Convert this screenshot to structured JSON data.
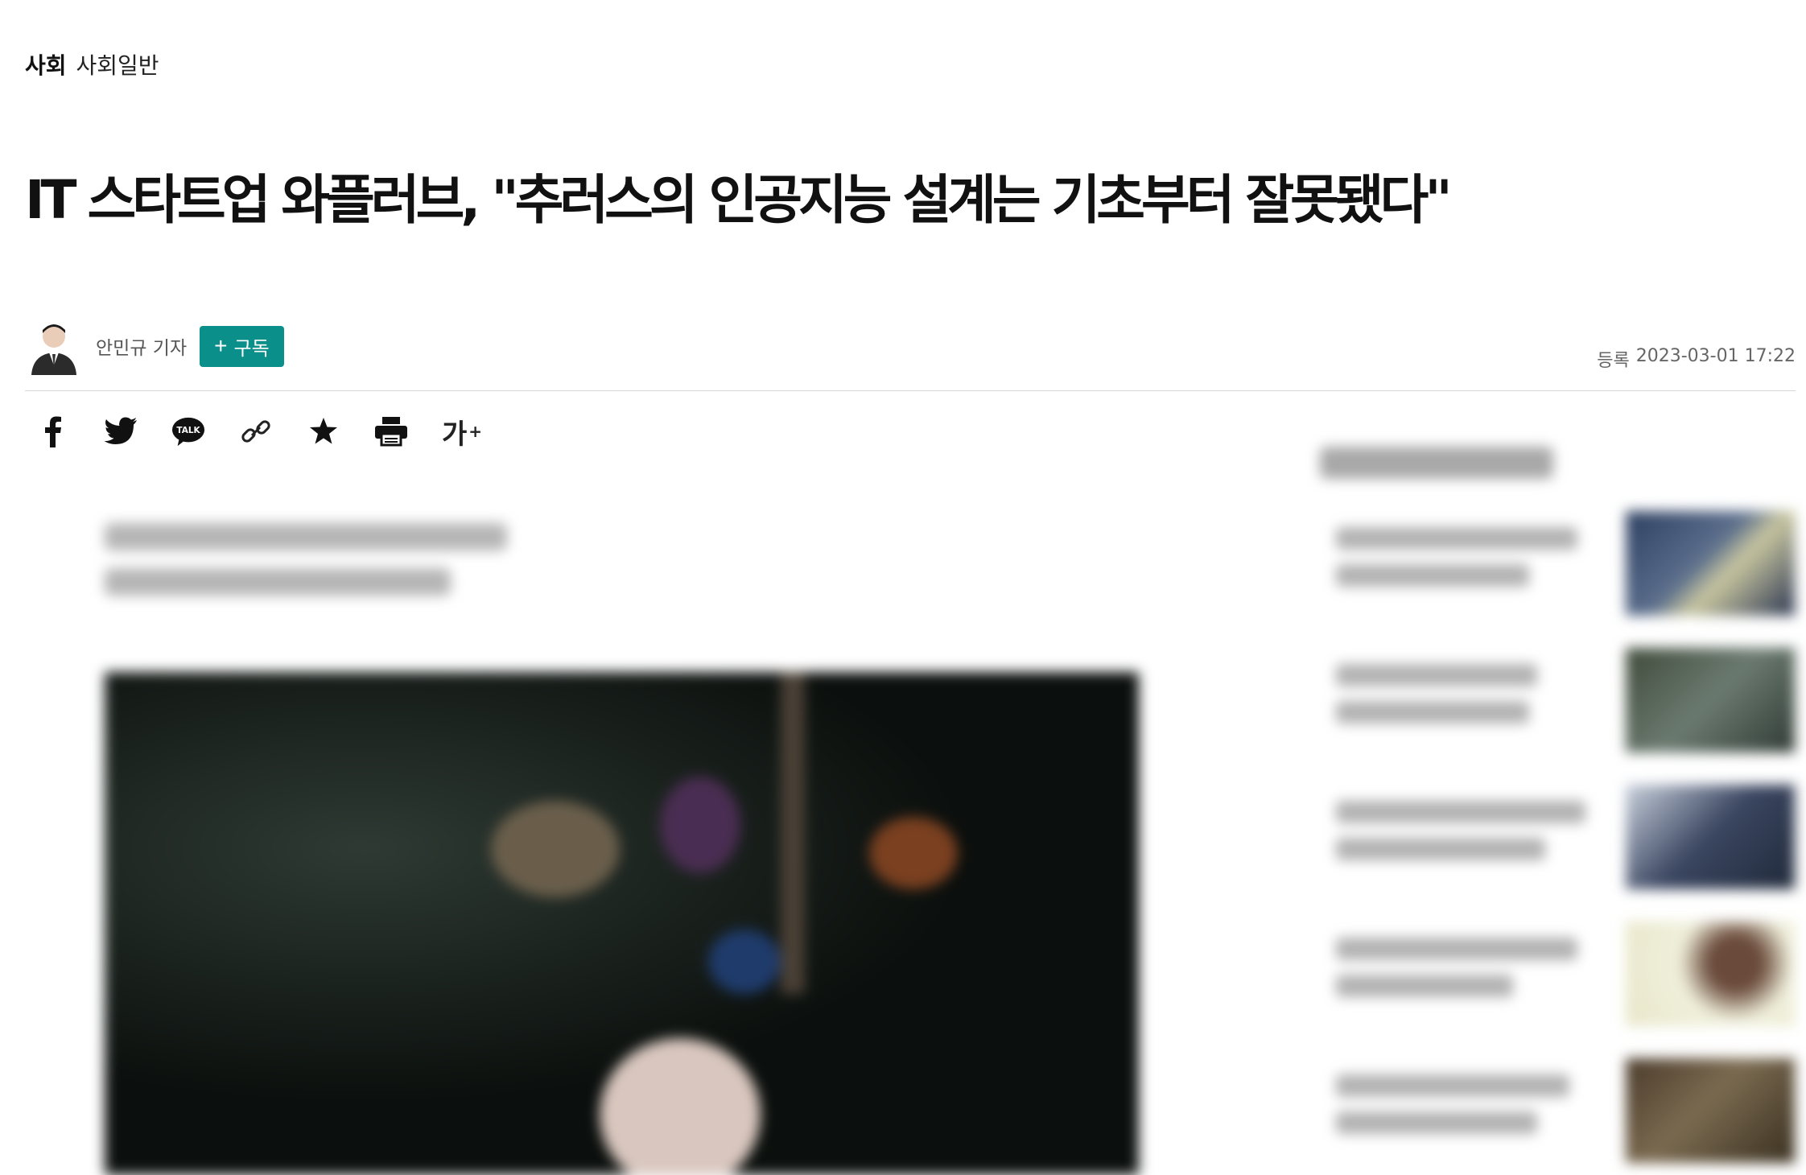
{
  "breadcrumb": {
    "section": "사회",
    "subsection": "사회일반"
  },
  "headline": "IT 스타트업 와플러브, \"추러스의 인공지능 설계는 기초부터 잘못됐다\"",
  "byline": {
    "author": "안민규 기자",
    "subscribe_label": "구독",
    "subscribe_icon": "+",
    "date_label": "등록",
    "date_value": "2023-03-01 17:22"
  },
  "toolbar": {
    "icons": [
      "facebook-icon",
      "twitter-icon",
      "kakaotalk-icon",
      "link-icon",
      "star-icon",
      "print-icon",
      "font-size-icon"
    ],
    "font_size_label": "가",
    "font_size_sup": "+",
    "talk_label": "TALK"
  },
  "colors": {
    "accent": "#0b8f8a",
    "divider": "#d8d8d8",
    "text": "#111111",
    "muted": "#666666"
  }
}
